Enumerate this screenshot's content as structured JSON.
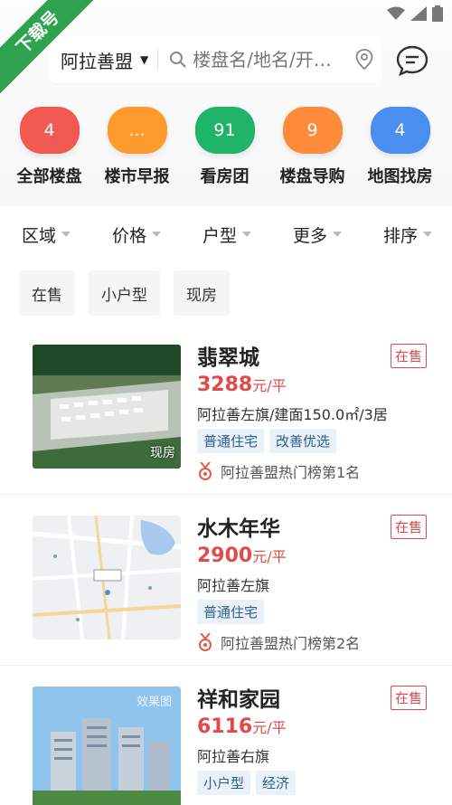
{
  "banner": {
    "label": "下载号"
  },
  "header": {
    "city": "阿拉善盟",
    "search_placeholder": "楼盘名/地名/开…"
  },
  "categories": [
    {
      "label": "全部楼盘",
      "badge": "4",
      "color": "#f05a52"
    },
    {
      "label": "楼市早报",
      "badge": "...",
      "color": "#ff9a2e"
    },
    {
      "label": "看房团",
      "badge": "91",
      "color": "#20b36a"
    },
    {
      "label": "楼盘导购",
      "badge": "9",
      "color": "#ff8b3a"
    },
    {
      "label": "地图找房",
      "badge": "4",
      "color": "#4a8ff0"
    }
  ],
  "filters": [
    "区域",
    "价格",
    "户型",
    "更多",
    "排序"
  ],
  "chips": [
    "在售",
    "小户型",
    "现房"
  ],
  "listings": [
    {
      "name": "翡翠城",
      "status": "在售",
      "price": "3288",
      "unit": "元/平",
      "address": "阿拉善左旗/建面150.0㎡/3居",
      "tags": [
        "普通住宅",
        "改善优选"
      ],
      "rank": "阿拉善盟热门榜第1名",
      "thumb_tag": "现房"
    },
    {
      "name": "水木年华",
      "status": "在售",
      "price": "2900",
      "unit": "元/平",
      "address": "阿拉善左旗",
      "tags": [
        "普通住宅"
      ],
      "rank": "阿拉善盟热门榜第2名",
      "thumb_tag": ""
    },
    {
      "name": "祥和家园",
      "status": "在售",
      "price": "6116",
      "unit": "元/平",
      "address": "阿拉善右旗",
      "tags": [
        "小户型",
        "经济"
      ],
      "rank": "",
      "thumb_tag": "效果图"
    }
  ]
}
